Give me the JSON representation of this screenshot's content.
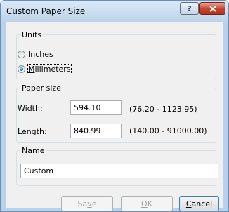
{
  "window": {
    "title": "Custom Paper Size",
    "help_glyph": "?",
    "close_glyph": "x"
  },
  "units": {
    "legend": "Units",
    "inches": {
      "accel": "I",
      "rest": "nches",
      "selected": false
    },
    "millimeters": {
      "accel": "M",
      "rest": "illimeters",
      "selected": true
    }
  },
  "paper_size": {
    "legend": "Paper size",
    "width": {
      "label_accel": "W",
      "label_rest": "idth:",
      "value": "594.10",
      "range": "(76.20 - 1123.95)"
    },
    "length": {
      "label": "Length:",
      "value": "840.99",
      "range": "(140.00 - 91000.00)"
    }
  },
  "name": {
    "legend_accel": "N",
    "legend_rest": "ame",
    "value": "Custom"
  },
  "buttons": {
    "save": {
      "pre": "Sa",
      "accel": "v",
      "post": "e",
      "enabled": false
    },
    "ok": {
      "accel": "O",
      "post": "K",
      "enabled": false
    },
    "cancel": {
      "accel": "C",
      "post": "ancel",
      "enabled": true,
      "default": true
    }
  }
}
